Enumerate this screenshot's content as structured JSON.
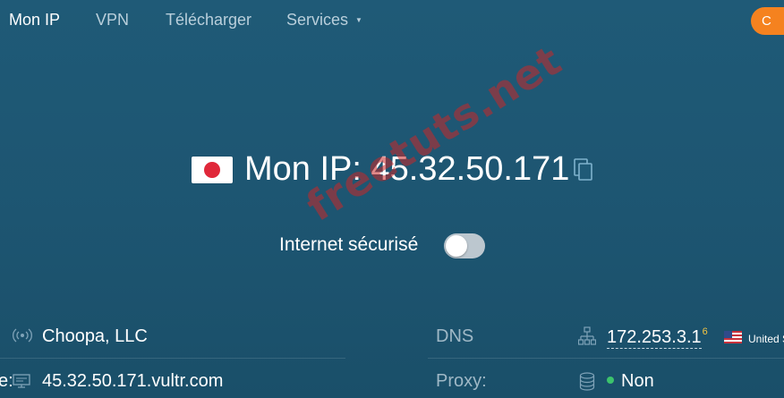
{
  "nav": {
    "items": [
      {
        "label": "Mon IP",
        "active": true
      },
      {
        "label": "VPN",
        "active": false
      },
      {
        "label": "Télécharger",
        "active": false
      },
      {
        "label": "Services",
        "active": false
      }
    ],
    "cta_label": "C"
  },
  "hero": {
    "flag": "japan-flag-icon",
    "title": "Mon IP: 45.32.50.171",
    "copy_icon": "copy-icon"
  },
  "secure": {
    "label": "Internet sécurisé",
    "enabled": false
  },
  "watermark": "freetuts.net",
  "info": {
    "isp": {
      "icon": "broadcast-icon",
      "value": "Choopa, LLC"
    },
    "host": {
      "label_fragment": "e:",
      "icon": "server-icon",
      "value": "45.32.50.171.vultr.com"
    },
    "dns": {
      "label": "DNS",
      "icon": "network-icon",
      "value": "172.253.3.1",
      "superscript": "6",
      "country": "United S",
      "country_flag": "us-flag-icon"
    },
    "proxy": {
      "label": "Proxy:",
      "icon": "database-icon",
      "value": "Non",
      "status_color": "#3cc36c"
    }
  },
  "colors": {
    "background": "#1f5a77",
    "accent": "#f5821f",
    "muted_text": "#b9cfdb"
  }
}
